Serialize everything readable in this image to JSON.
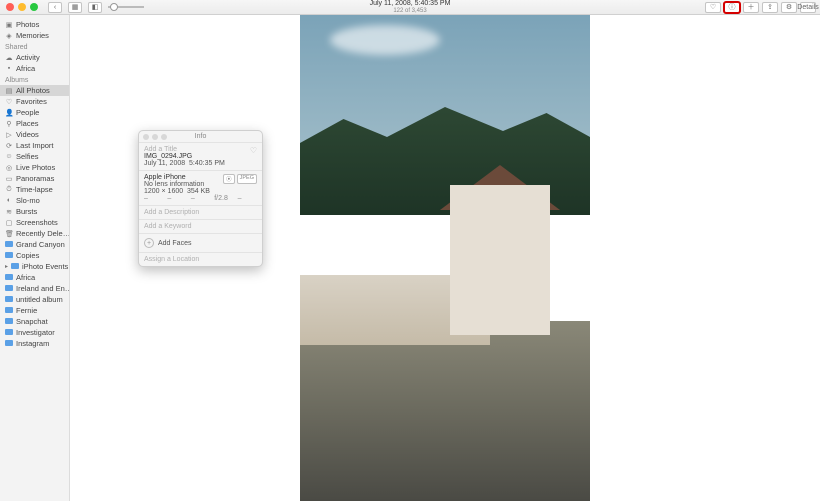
{
  "toolbar": {
    "title_line1": "July 11, 2008, 5:40:35 PM",
    "title_line2": "122 of 3,453",
    "details_label": "Details"
  },
  "sidebar": {
    "sections": [
      {
        "header": null,
        "items": [
          {
            "icon": "photos-icon",
            "label": "Photos"
          },
          {
            "icon": "memories-icon",
            "label": "Memories"
          }
        ]
      },
      {
        "header": "Shared",
        "items": [
          {
            "icon": "activity-icon",
            "label": "Activity"
          },
          {
            "icon": "shared-album-icon",
            "label": "Africa"
          }
        ]
      },
      {
        "header": "Albums",
        "items": [
          {
            "icon": "all-photos-icon",
            "label": "All Photos",
            "selected": true
          },
          {
            "icon": "favorites-icon",
            "label": "Favorites"
          },
          {
            "icon": "people-icon",
            "label": "People"
          },
          {
            "icon": "places-icon",
            "label": "Places"
          },
          {
            "icon": "videos-icon",
            "label": "Videos"
          },
          {
            "icon": "last-import-icon",
            "label": "Last Import"
          },
          {
            "icon": "selfies-icon",
            "label": "Selfies"
          },
          {
            "icon": "live-photos-icon",
            "label": "Live Photos"
          },
          {
            "icon": "panoramas-icon",
            "label": "Panoramas"
          },
          {
            "icon": "timelapse-icon",
            "label": "Time-lapse"
          },
          {
            "icon": "slomo-icon",
            "label": "Slo-mo"
          },
          {
            "icon": "bursts-icon",
            "label": "Bursts"
          },
          {
            "icon": "screenshots-icon",
            "label": "Screenshots"
          },
          {
            "icon": "trash-icon",
            "label": "Recently Dele…"
          },
          {
            "icon": "folder-icon",
            "label": "Grand Canyon"
          },
          {
            "icon": "folder-icon",
            "label": "Copies"
          },
          {
            "icon": "folder-group-icon",
            "label": "iPhoto Events",
            "expandable": true
          },
          {
            "icon": "folder-icon",
            "label": "Africa"
          },
          {
            "icon": "folder-icon",
            "label": "Ireland and En…"
          },
          {
            "icon": "folder-icon",
            "label": "untitled album"
          },
          {
            "icon": "folder-icon",
            "label": "Fernie"
          },
          {
            "icon": "folder-icon",
            "label": "Snapchat"
          },
          {
            "icon": "folder-icon",
            "label": "Investigator"
          },
          {
            "icon": "folder-icon",
            "label": "Instagram"
          }
        ]
      }
    ]
  },
  "info": {
    "title": "Info",
    "add_title_ph": "Add a Title",
    "filename": "IMG_0294.JPG",
    "date": "July 11, 2008",
    "time": "5:40:35 PM",
    "device": "Apple iPhone",
    "lens": "No lens information",
    "dimensions": "1200 × 1600",
    "filesize": "354 KB",
    "badge1": "⦿",
    "badge2": "JPEG",
    "iso": "–",
    "focal": "–",
    "ev": "–",
    "aperture": "f/2.8",
    "shutter": "–",
    "desc_ph": "Add a Description",
    "keyword_ph": "Add a Keyword",
    "faces_label": "Add Faces",
    "location_ph": "Assign a Location"
  }
}
